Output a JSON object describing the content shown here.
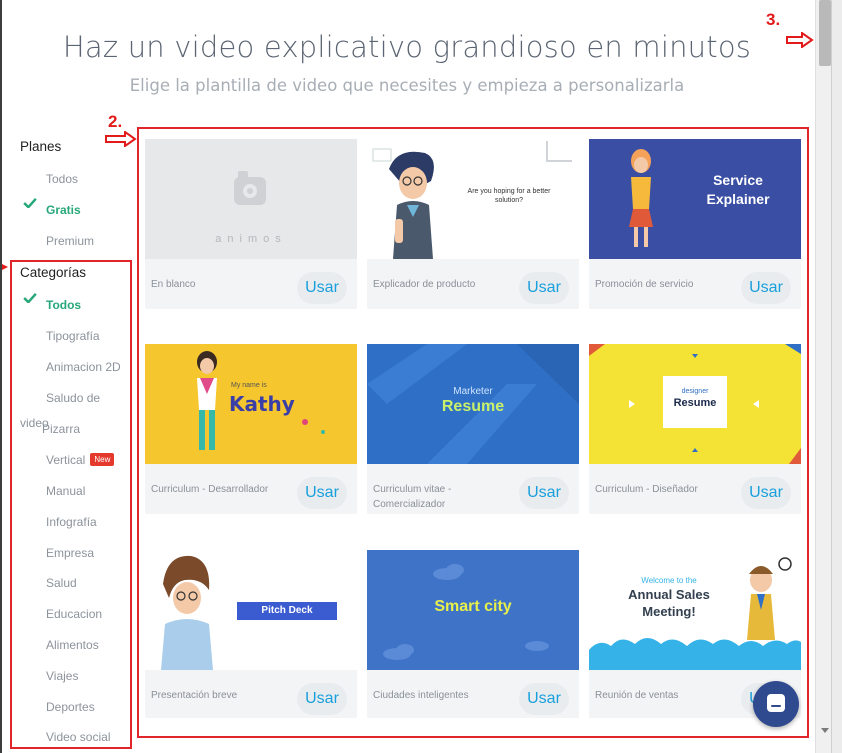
{
  "header": {
    "title": "Haz un video explicativo grandioso en minutos",
    "subtitle": "Elige la plantilla de video que necesites y empieza a personalizarla"
  },
  "annotations": {
    "three": "3.",
    "two": "2."
  },
  "sidebar": {
    "plans_heading": "Planes",
    "plans": [
      {
        "label": "Todos",
        "active": false
      },
      {
        "label": "Gratis",
        "active": true
      },
      {
        "label": "Premium",
        "active": false
      }
    ],
    "categories_heading": "Categorías",
    "categories": [
      {
        "label": "Todos",
        "active": true
      },
      {
        "label": "Tipografía"
      },
      {
        "label": "Animacion 2D"
      },
      {
        "label": "Saludo de"
      },
      {
        "label": "Pizarra"
      },
      {
        "label": "Vertical",
        "badge": "New"
      },
      {
        "label": "Manual"
      },
      {
        "label": "Infografía"
      },
      {
        "label": "Empresa"
      },
      {
        "label": "Salud"
      },
      {
        "label": "Educacion"
      },
      {
        "label": "Alimentos"
      },
      {
        "label": "Viajes"
      },
      {
        "label": "Deportes"
      },
      {
        "label": "Video social"
      }
    ],
    "video_prefix": "video"
  },
  "cards": [
    {
      "label": "En blanco",
      "button": "Usar",
      "thumb_text": "animos"
    },
    {
      "label": "Explicador de producto",
      "button": "Usar",
      "thumb_text": "Are you hoping for a better solution?"
    },
    {
      "label": "Promoción de servicio",
      "button": "Usar",
      "thumb_line1": "Service",
      "thumb_line2": "Explainer"
    },
    {
      "label": "Curriculum - Desarrollador",
      "button": "Usar",
      "thumb_small": "My name is",
      "thumb_big": "Kathy"
    },
    {
      "label": "Curriculum vitae - Comercializador",
      "button": "Usar",
      "thumb_small": "Marketer",
      "thumb_big": "Resume"
    },
    {
      "label": "Curriculum - Diseñador",
      "button": "Usar",
      "thumb_small": "designer",
      "thumb_big": "Resume"
    },
    {
      "label": "Presentación breve",
      "button": "Usar",
      "thumb_text": "Pitch Deck"
    },
    {
      "label": "Ciudades inteligentes",
      "button": "Usar",
      "thumb_text": "Smart city"
    },
    {
      "label": "Reunión de ventas",
      "button": "Usar",
      "thumb_small": "Welcome to the",
      "thumb_line1": "Annual Sales",
      "thumb_line2": "Meeting!"
    }
  ],
  "colors": {
    "accent_green": "#28a87a",
    "button_text": "#19a0dc",
    "annotation_red": "#e21a1a",
    "chat_button": "#2f4a8f"
  },
  "icons": [
    "checkmark-icon",
    "chat-icon",
    "arrow-right-icon",
    "scroll-down-icon"
  ]
}
